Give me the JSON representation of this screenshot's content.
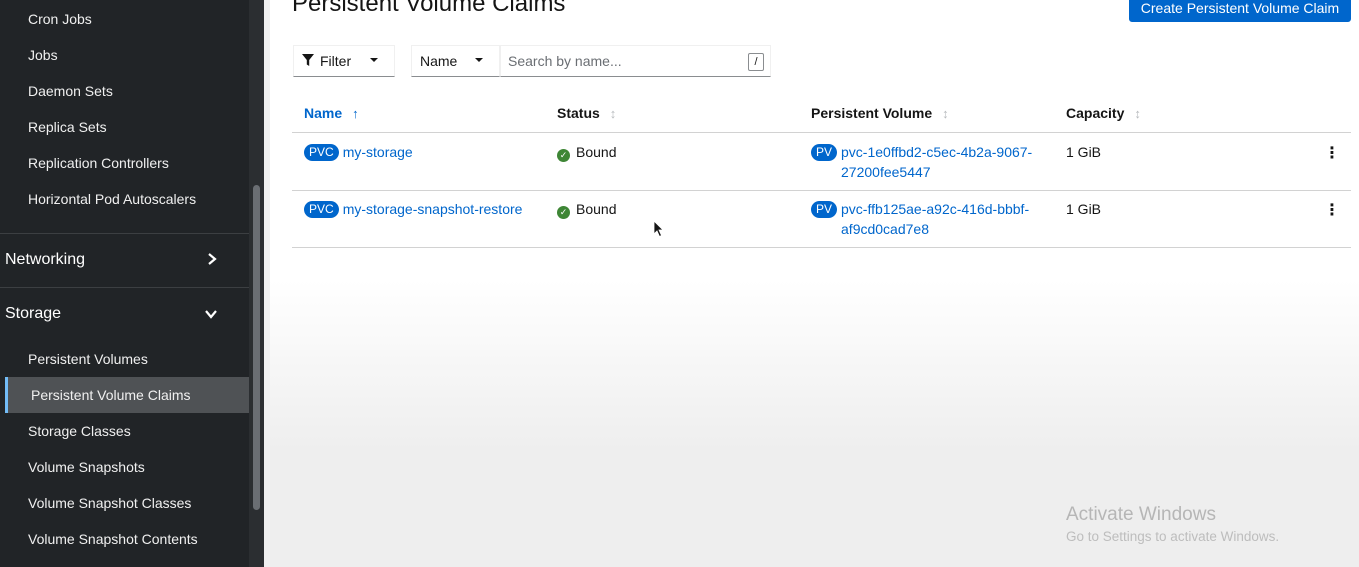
{
  "sidebar": {
    "workloads_items": [
      {
        "label": "Cron Jobs"
      },
      {
        "label": "Jobs"
      },
      {
        "label": "Daemon Sets"
      },
      {
        "label": "Replica Sets"
      },
      {
        "label": "Replication Controllers"
      },
      {
        "label": "Horizontal Pod Autoscalers"
      }
    ],
    "networking": {
      "label": "Networking",
      "icon": "chevron-right-icon"
    },
    "storage": {
      "label": "Storage",
      "icon": "chevron-down-icon"
    },
    "storage_items": [
      {
        "label": "Persistent Volumes"
      },
      {
        "label": "Persistent Volume Claims",
        "active": true
      },
      {
        "label": "Storage Classes"
      },
      {
        "label": "Volume Snapshots"
      },
      {
        "label": "Volume Snapshot Classes"
      },
      {
        "label": "Volume Snapshot Contents"
      }
    ]
  },
  "page": {
    "title": "Persistent Volume Claims",
    "create_button": "Create Persistent Volume Claim"
  },
  "toolbar": {
    "filter_label": "Filter",
    "name_label": "Name",
    "search_placeholder": "Search by name...",
    "search_shortcut": "/"
  },
  "table": {
    "headers": {
      "name": "Name",
      "status": "Status",
      "persistent_volume": "Persistent Volume",
      "capacity": "Capacity"
    },
    "rows": [
      {
        "badge": "PVC",
        "name": "my-storage",
        "status": "Bound",
        "pv_badge": "PV",
        "pv_line1": "pvc-1e0ffbd2-c5ec-4b2a-9067-",
        "pv_line2": "27200fee5447",
        "capacity": "1 GiB"
      },
      {
        "badge": "PVC",
        "name": "my-storage-snapshot-restore",
        "status": "Bound",
        "pv_badge": "PV",
        "pv_line1": "pvc-ffb125ae-a92c-416d-bbbf-",
        "pv_line2": "af9cd0cad7e8",
        "capacity": "1 GiB"
      }
    ]
  },
  "watermark": {
    "line1": "Activate Windows",
    "line2": "Go to Settings to activate Windows."
  },
  "colors": {
    "sidebar_bg": "#212427",
    "primary": "#0066cc",
    "status_ok": "#3e8635"
  }
}
